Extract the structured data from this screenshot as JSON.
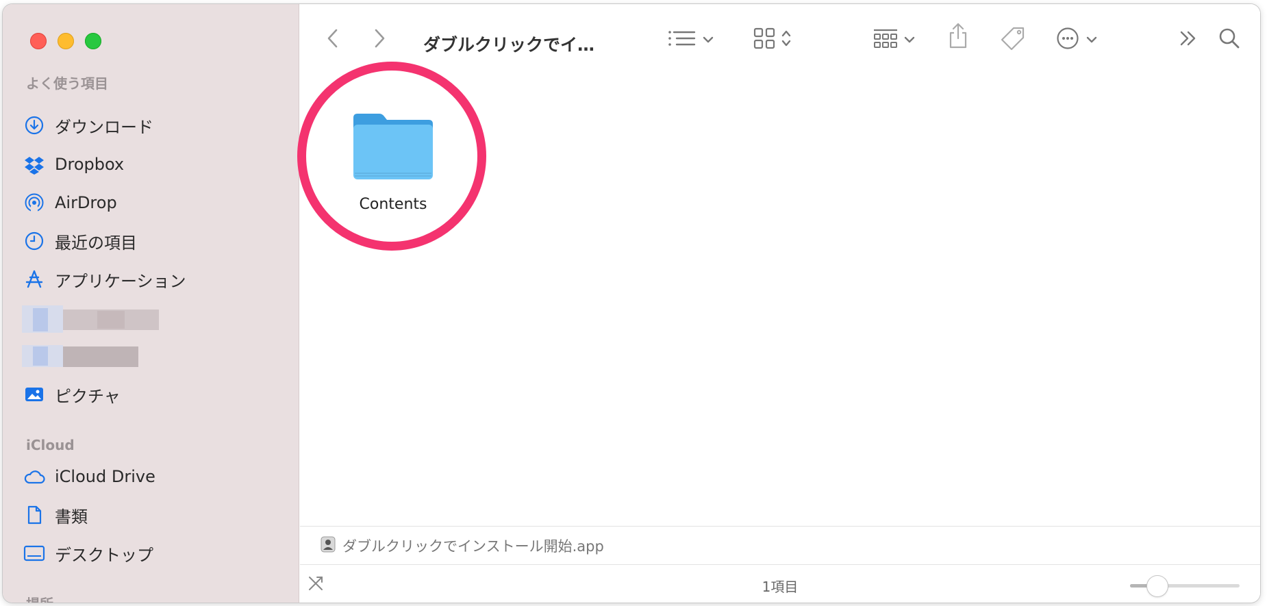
{
  "window": {
    "title": "ダブルクリックでイ…"
  },
  "sidebar": {
    "favorites_title": "よく使う項目",
    "favorites": [
      {
        "label": "ダウンロード",
        "icon": "download-icon"
      },
      {
        "label": "Dropbox",
        "icon": "dropbox-icon"
      },
      {
        "label": "AirDrop",
        "icon": "airdrop-icon"
      },
      {
        "label": "最近の項目",
        "icon": "clock-icon"
      },
      {
        "label": "アプリケーション",
        "icon": "applications-icon"
      },
      {
        "label": "ピクチャ",
        "icon": "photo-icon"
      }
    ],
    "icloud_title": "iCloud",
    "icloud": [
      {
        "label": "iCloud Drive",
        "icon": "cloud-icon"
      },
      {
        "label": "書類",
        "icon": "document-icon"
      },
      {
        "label": "デスクトップ",
        "icon": "desktop-icon"
      }
    ],
    "locations_title": "場所"
  },
  "main": {
    "items": [
      {
        "name": "Contents",
        "icon": "folder-icon"
      }
    ]
  },
  "pathbar": {
    "path": "ダブルクリックでインストール開始.app"
  },
  "statusbar": {
    "count": "1項目",
    "icon_size_level": 0.25
  },
  "colors": {
    "sidebar_bg": "#e9dfe0",
    "accent": "#1a73e8",
    "highlight": "#f4336f",
    "folder": "#6cc4f6"
  }
}
